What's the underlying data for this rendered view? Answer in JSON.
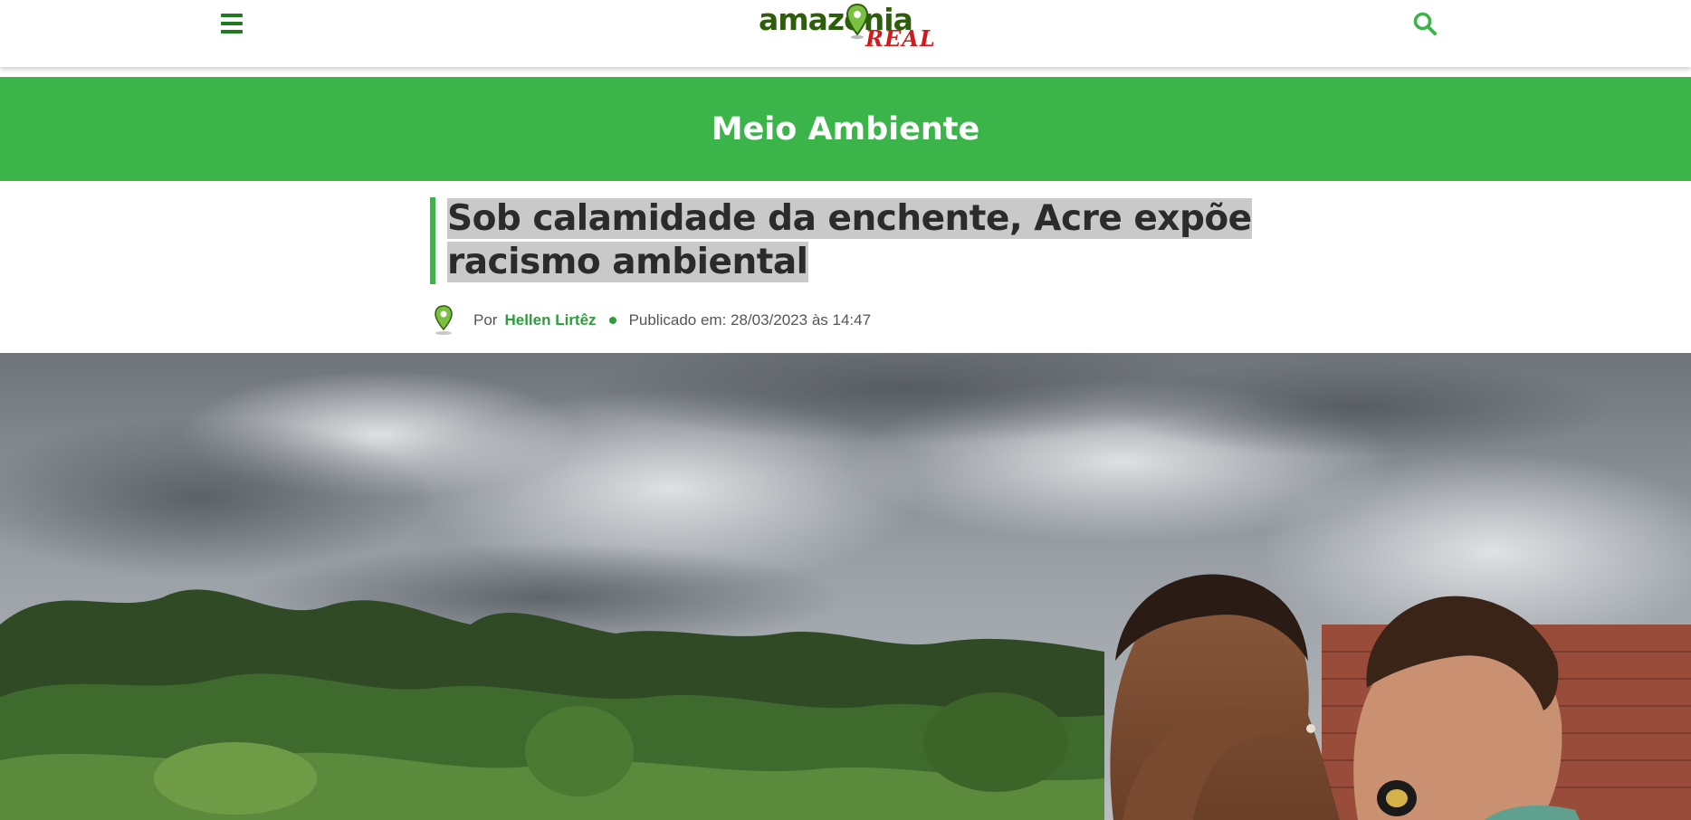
{
  "header": {
    "logo_main": "amazonia",
    "logo_sub": "REAL",
    "menu_icon": "hamburger-menu-icon",
    "search_icon": "search-icon",
    "colors": {
      "brand_green": "#3bb54a",
      "dark_green": "#1f7a1f",
      "logo_red": "#d11a1a"
    }
  },
  "category": {
    "label": "Meio Ambiente"
  },
  "article": {
    "title": "Sob calamidade da enchente, Acre expõe racismo ambiental",
    "byline_prefix": "Por",
    "author": "Hellen Lirtêz",
    "published": "Publicado em: 28/03/2023 às 14:47"
  },
  "hero_image": {
    "description_icon": "flood-photo-image"
  }
}
